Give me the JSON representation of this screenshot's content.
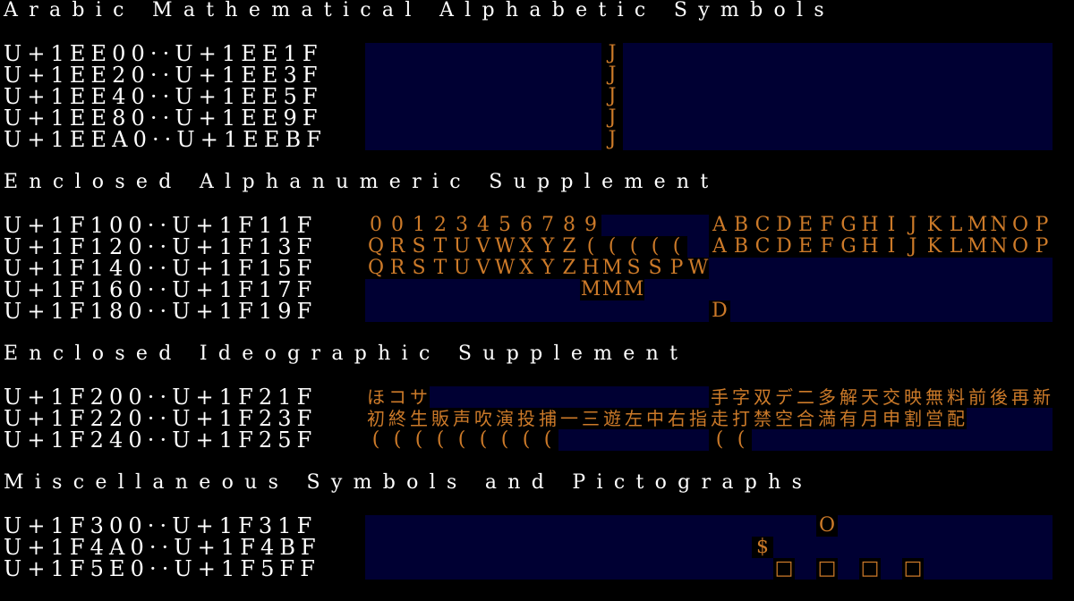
{
  "colors": {
    "background": "#000000",
    "header_text": "#ffffff",
    "block_background": "#000033",
    "glyph_text": "#cc7a29"
  },
  "sections": [
    {
      "title": "Arabic Mathematical Alphabetic Symbols",
      "rows": [
        {
          "range": "U+1EE00··U+1EE1F",
          "glyphs": [
            {
              "col": 11,
              "char": "J"
            }
          ]
        },
        {
          "range": "U+1EE20··U+1EE3F",
          "glyphs": [
            {
              "col": 11,
              "char": "J"
            }
          ]
        },
        {
          "range": "U+1EE40··U+1EE5F",
          "glyphs": [
            {
              "col": 11,
              "char": "J"
            }
          ]
        },
        {
          "range": "U+1EE80··U+1EE9F",
          "glyphs": [
            {
              "col": 11,
              "char": "J"
            }
          ]
        },
        {
          "range": "U+1EEA0··U+1EEBF",
          "glyphs": [
            {
              "col": 11,
              "char": "J"
            }
          ]
        }
      ]
    },
    {
      "title": "Enclosed Alphanumeric Supplement",
      "rows": [
        {
          "range": "U+1F100··U+1F11F",
          "glyphs": [
            {
              "col": 0,
              "char": "0"
            },
            {
              "col": 1,
              "char": "0"
            },
            {
              "col": 2,
              "char": "1"
            },
            {
              "col": 3,
              "char": "2"
            },
            {
              "col": 4,
              "char": "3"
            },
            {
              "col": 5,
              "char": "4"
            },
            {
              "col": 6,
              "char": "5"
            },
            {
              "col": 7,
              "char": "6"
            },
            {
              "col": 8,
              "char": "7"
            },
            {
              "col": 9,
              "char": "8"
            },
            {
              "col": 10,
              "char": "9"
            },
            {
              "col": 16,
              "char": "A"
            },
            {
              "col": 17,
              "char": "B"
            },
            {
              "col": 18,
              "char": "C"
            },
            {
              "col": 19,
              "char": "D"
            },
            {
              "col": 20,
              "char": "E"
            },
            {
              "col": 21,
              "char": "F"
            },
            {
              "col": 22,
              "char": "G"
            },
            {
              "col": 23,
              "char": "H"
            },
            {
              "col": 24,
              "char": "I"
            },
            {
              "col": 25,
              "char": "J"
            },
            {
              "col": 26,
              "char": "K"
            },
            {
              "col": 27,
              "char": "L"
            },
            {
              "col": 28,
              "char": "M"
            },
            {
              "col": 29,
              "char": "N"
            },
            {
              "col": 30,
              "char": "O"
            },
            {
              "col": 31,
              "char": "P"
            }
          ]
        },
        {
          "range": "U+1F120··U+1F13F",
          "glyphs": [
            {
              "col": 0,
              "char": "Q"
            },
            {
              "col": 1,
              "char": "R"
            },
            {
              "col": 2,
              "char": "S"
            },
            {
              "col": 3,
              "char": "T"
            },
            {
              "col": 4,
              "char": "U"
            },
            {
              "col": 5,
              "char": "V"
            },
            {
              "col": 6,
              "char": "W"
            },
            {
              "col": 7,
              "char": "X"
            },
            {
              "col": 8,
              "char": "Y"
            },
            {
              "col": 9,
              "char": "Z"
            },
            {
              "col": 10,
              "char": "("
            },
            {
              "col": 11,
              "char": "("
            },
            {
              "col": 12,
              "char": "("
            },
            {
              "col": 13,
              "char": "("
            },
            {
              "col": 14,
              "char": "("
            },
            {
              "col": 16,
              "char": "A"
            },
            {
              "col": 17,
              "char": "B"
            },
            {
              "col": 18,
              "char": "C"
            },
            {
              "col": 19,
              "char": "D"
            },
            {
              "col": 20,
              "char": "E"
            },
            {
              "col": 21,
              "char": "F"
            },
            {
              "col": 22,
              "char": "G"
            },
            {
              "col": 23,
              "char": "H"
            },
            {
              "col": 24,
              "char": "I"
            },
            {
              "col": 25,
              "char": "J"
            },
            {
              "col": 26,
              "char": "K"
            },
            {
              "col": 27,
              "char": "L"
            },
            {
              "col": 28,
              "char": "M"
            },
            {
              "col": 29,
              "char": "N"
            },
            {
              "col": 30,
              "char": "O"
            },
            {
              "col": 31,
              "char": "P"
            }
          ]
        },
        {
          "range": "U+1F140··U+1F15F",
          "glyphs": [
            {
              "col": 0,
              "char": "Q"
            },
            {
              "col": 1,
              "char": "R"
            },
            {
              "col": 2,
              "char": "S"
            },
            {
              "col": 3,
              "char": "T"
            },
            {
              "col": 4,
              "char": "U"
            },
            {
              "col": 5,
              "char": "V"
            },
            {
              "col": 6,
              "char": "W"
            },
            {
              "col": 7,
              "char": "X"
            },
            {
              "col": 8,
              "char": "Y"
            },
            {
              "col": 9,
              "char": "Z"
            },
            {
              "col": 10,
              "char": "H"
            },
            {
              "col": 11,
              "char": "M"
            },
            {
              "col": 12,
              "char": "S"
            },
            {
              "col": 13,
              "char": "S"
            },
            {
              "col": 14,
              "char": "P"
            },
            {
              "col": 15,
              "char": "W"
            }
          ]
        },
        {
          "range": "U+1F160··U+1F17F",
          "glyphs": [
            {
              "col": 10,
              "char": "M"
            },
            {
              "col": 11,
              "char": "M"
            },
            {
              "col": 12,
              "char": "M"
            }
          ]
        },
        {
          "range": "U+1F180··U+1F19F",
          "glyphs": [
            {
              "col": 16,
              "char": "D"
            }
          ]
        }
      ]
    },
    {
      "title": "Enclosed Ideographic Supplement",
      "rows": [
        {
          "range": "U+1F200··U+1F21F",
          "glyphs": [
            {
              "col": 0,
              "char": "ほ"
            },
            {
              "col": 1,
              "char": "コ"
            },
            {
              "col": 2,
              "char": "サ"
            },
            {
              "col": 16,
              "char": "手"
            },
            {
              "col": 17,
              "char": "字"
            },
            {
              "col": 18,
              "char": "双"
            },
            {
              "col": 19,
              "char": "デ"
            },
            {
              "col": 20,
              "char": "二"
            },
            {
              "col": 21,
              "char": "多"
            },
            {
              "col": 22,
              "char": "解"
            },
            {
              "col": 23,
              "char": "天"
            },
            {
              "col": 24,
              "char": "交"
            },
            {
              "col": 25,
              "char": "映"
            },
            {
              "col": 26,
              "char": "無"
            },
            {
              "col": 27,
              "char": "料"
            },
            {
              "col": 28,
              "char": "前"
            },
            {
              "col": 29,
              "char": "後"
            },
            {
              "col": 30,
              "char": "再"
            },
            {
              "col": 31,
              "char": "新"
            }
          ]
        },
        {
          "range": "U+1F220··U+1F23F",
          "glyphs": [
            {
              "col": 0,
              "char": "初"
            },
            {
              "col": 1,
              "char": "終"
            },
            {
              "col": 2,
              "char": "生"
            },
            {
              "col": 3,
              "char": "販"
            },
            {
              "col": 4,
              "char": "声"
            },
            {
              "col": 5,
              "char": "吹"
            },
            {
              "col": 6,
              "char": "演"
            },
            {
              "col": 7,
              "char": "投"
            },
            {
              "col": 8,
              "char": "捕"
            },
            {
              "col": 9,
              "char": "一"
            },
            {
              "col": 10,
              "char": "三"
            },
            {
              "col": 11,
              "char": "遊"
            },
            {
              "col": 12,
              "char": "左"
            },
            {
              "col": 13,
              "char": "中"
            },
            {
              "col": 14,
              "char": "右"
            },
            {
              "col": 15,
              "char": "指"
            },
            {
              "col": 16,
              "char": "走"
            },
            {
              "col": 17,
              "char": "打"
            },
            {
              "col": 18,
              "char": "禁"
            },
            {
              "col": 19,
              "char": "空"
            },
            {
              "col": 20,
              "char": "合"
            },
            {
              "col": 21,
              "char": "満"
            },
            {
              "col": 22,
              "char": "有"
            },
            {
              "col": 23,
              "char": "月"
            },
            {
              "col": 24,
              "char": "申"
            },
            {
              "col": 25,
              "char": "割"
            },
            {
              "col": 26,
              "char": "営"
            },
            {
              "col": 27,
              "char": "配"
            }
          ]
        },
        {
          "range": "U+1F240··U+1F25F",
          "glyphs": [
            {
              "col": 0,
              "char": "("
            },
            {
              "col": 1,
              "char": "("
            },
            {
              "col": 2,
              "char": "("
            },
            {
              "col": 3,
              "char": "("
            },
            {
              "col": 4,
              "char": "("
            },
            {
              "col": 5,
              "char": "("
            },
            {
              "col": 6,
              "char": "("
            },
            {
              "col": 7,
              "char": "("
            },
            {
              "col": 8,
              "char": "("
            },
            {
              "col": 16,
              "char": "("
            },
            {
              "col": 17,
              "char": "("
            }
          ]
        }
      ]
    },
    {
      "title": "Miscellaneous Symbols and Pictographs",
      "rows": [
        {
          "range": "U+1F300··U+1F31F",
          "glyphs": [
            {
              "col": 21,
              "char": "O"
            }
          ]
        },
        {
          "range": "U+1F4A0··U+1F4BF",
          "glyphs": [
            {
              "col": 18,
              "char": "$"
            }
          ]
        },
        {
          "range": "U+1F5E0··U+1F5FF",
          "glyphs": [
            {
              "col": 19,
              "char": "□"
            },
            {
              "col": 21,
              "char": "□"
            },
            {
              "col": 23,
              "char": "□"
            },
            {
              "col": 25,
              "char": "□"
            }
          ]
        }
      ]
    }
  ]
}
